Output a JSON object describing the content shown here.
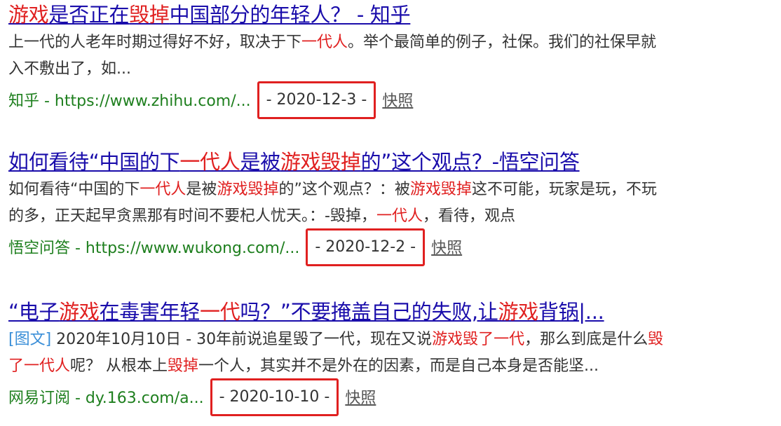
{
  "results": [
    {
      "title": [
        {
          "t": "游戏",
          "hl": true
        },
        {
          "t": "是否正在",
          "hl": false
        },
        {
          "t": "毁掉",
          "hl": true
        },
        {
          "t": "中国部分的年轻人？ - 知乎",
          "hl": false
        }
      ],
      "desc_lines": [
        [
          {
            "t": "上一代的人老年时期过得好不好，取决于下",
            "hl": false
          },
          {
            "t": "一代人",
            "hl": true
          },
          {
            "t": "。举个最简单的例子，社保。我们的社保早就",
            "hl": false
          }
        ],
        [
          {
            "t": "入不敷出了，如...",
            "hl": false
          }
        ]
      ],
      "source": "知乎 - https://www.zhihu.com/...",
      "date": "- 2020-12-3 -",
      "snapshot": "快照"
    },
    {
      "title": [
        {
          "t": "如何看待“中国的下",
          "hl": false
        },
        {
          "t": "一代人",
          "hl": true
        },
        {
          "t": "是被",
          "hl": false
        },
        {
          "t": "游戏毁掉",
          "hl": true
        },
        {
          "t": "的”这个观点？-悟空问答",
          "hl": false
        }
      ],
      "desc_lines": [
        [
          {
            "t": "如何看待“中国的下",
            "hl": false
          },
          {
            "t": "一代人",
            "hl": true
          },
          {
            "t": "是被",
            "hl": false
          },
          {
            "t": "游戏毁掉",
            "hl": true
          },
          {
            "t": "的”这个观点？：被",
            "hl": false
          },
          {
            "t": "游戏毁掉",
            "hl": true
          },
          {
            "t": "这不可能，玩家是玩，不玩",
            "hl": false
          }
        ],
        [
          {
            "t": "的多，正天起早贪黑那有时间不要杞人忧天。：-毁掉，",
            "hl": false
          },
          {
            "t": "一代人",
            "hl": true
          },
          {
            "t": "，看待，观点",
            "hl": false
          }
        ]
      ],
      "source": "悟空问答 - https://www.wukong.com/...",
      "date": "- 2020-12-2 -",
      "snapshot": "快照"
    },
    {
      "title": [
        {
          "t": "“电子",
          "hl": false
        },
        {
          "t": "游戏",
          "hl": true
        },
        {
          "t": "在毒害年轻",
          "hl": false
        },
        {
          "t": "一代",
          "hl": true
        },
        {
          "t": "吗？”不要掩盖自己的失败,让",
          "hl": false
        },
        {
          "t": "游戏",
          "hl": true
        },
        {
          "t": "背锅|...",
          "hl": false
        }
      ],
      "tag": "[图文]",
      "desc_lines": [
        [
          {
            "t": " 2020年10月10日 - 30年前说追星毁了一代，现在又说",
            "hl": false
          },
          {
            "t": "游戏毁了一代",
            "hl": true
          },
          {
            "t": "，那么到底是什么",
            "hl": false
          },
          {
            "t": "毁",
            "hl": true
          }
        ],
        [
          {
            "t": "了一代人",
            "hl": true
          },
          {
            "t": "呢？ 从根本上",
            "hl": false
          },
          {
            "t": "毁掉",
            "hl": true
          },
          {
            "t": "一个人，其实并不是外在的因素，而是自己本身是否能坚...",
            "hl": false
          }
        ]
      ],
      "source": "网易订阅 - dy.163.com/a...",
      "date": "- 2020-10-10 -",
      "snapshot": "快照"
    }
  ]
}
